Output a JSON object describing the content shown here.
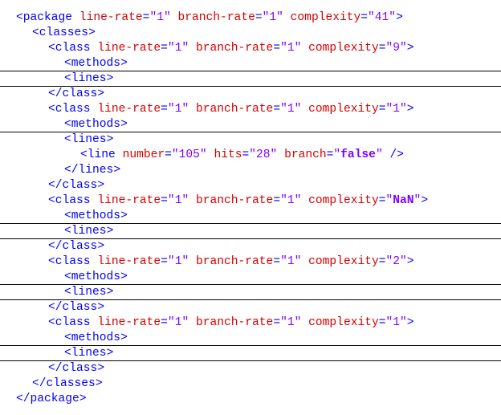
{
  "document": {
    "lines": [
      {
        "depth": 0,
        "tag": "package",
        "kind": "open",
        "attrs": [
          {
            "name": "line-rate",
            "value": "1"
          },
          {
            "name": "branch-rate",
            "value": "1"
          },
          {
            "name": "complexity",
            "value": "41"
          }
        ]
      },
      {
        "depth": 1,
        "tag": "classes",
        "kind": "open",
        "attrs": []
      },
      {
        "depth": 2,
        "tag": "class",
        "kind": "open",
        "attrs": [
          {
            "name": "line-rate",
            "value": "1"
          },
          {
            "name": "branch-rate",
            "value": "1"
          },
          {
            "name": "complexity",
            "value": "9"
          }
        ]
      },
      {
        "depth": 3,
        "tag": "methods",
        "kind": "open",
        "attrs": [],
        "separator": true
      },
      {
        "depth": 3,
        "tag": "lines",
        "kind": "open",
        "attrs": [],
        "separator": true
      },
      {
        "depth": 2,
        "tag": "class",
        "kind": "close",
        "attrs": []
      },
      {
        "depth": 2,
        "tag": "class",
        "kind": "open",
        "attrs": [
          {
            "name": "line-rate",
            "value": "1"
          },
          {
            "name": "branch-rate",
            "value": "1"
          },
          {
            "name": "complexity",
            "value": "1"
          }
        ]
      },
      {
        "depth": 3,
        "tag": "methods",
        "kind": "open",
        "attrs": [],
        "separator": true
      },
      {
        "depth": 3,
        "tag": "lines",
        "kind": "open",
        "attrs": []
      },
      {
        "depth": 4,
        "tag": "line",
        "kind": "selfclose",
        "attrs": [
          {
            "name": "number",
            "value": "105"
          },
          {
            "name": "hits",
            "value": "28"
          },
          {
            "name": "branch",
            "value": "false",
            "bold": true
          }
        ]
      },
      {
        "depth": 3,
        "tag": "lines",
        "kind": "close",
        "attrs": []
      },
      {
        "depth": 2,
        "tag": "class",
        "kind": "close",
        "attrs": []
      },
      {
        "depth": 2,
        "tag": "class",
        "kind": "open",
        "attrs": [
          {
            "name": "line-rate",
            "value": "1"
          },
          {
            "name": "branch-rate",
            "value": "1"
          },
          {
            "name": "complexity",
            "value": "NaN",
            "bold": true
          }
        ]
      },
      {
        "depth": 3,
        "tag": "methods",
        "kind": "open",
        "attrs": [],
        "separator": true
      },
      {
        "depth": 3,
        "tag": "lines",
        "kind": "open",
        "attrs": [],
        "separator": true
      },
      {
        "depth": 2,
        "tag": "class",
        "kind": "close",
        "attrs": []
      },
      {
        "depth": 2,
        "tag": "class",
        "kind": "open",
        "attrs": [
          {
            "name": "line-rate",
            "value": "1"
          },
          {
            "name": "branch-rate",
            "value": "1"
          },
          {
            "name": "complexity",
            "value": "2"
          }
        ]
      },
      {
        "depth": 3,
        "tag": "methods",
        "kind": "open",
        "attrs": [],
        "separator": true
      },
      {
        "depth": 3,
        "tag": "lines",
        "kind": "open",
        "attrs": [],
        "separator": true
      },
      {
        "depth": 2,
        "tag": "class",
        "kind": "close",
        "attrs": []
      },
      {
        "depth": 2,
        "tag": "class",
        "kind": "open",
        "attrs": [
          {
            "name": "line-rate",
            "value": "1"
          },
          {
            "name": "branch-rate",
            "value": "1"
          },
          {
            "name": "complexity",
            "value": "1"
          }
        ]
      },
      {
        "depth": 3,
        "tag": "methods",
        "kind": "open",
        "attrs": [],
        "separator": true
      },
      {
        "depth": 3,
        "tag": "lines",
        "kind": "open",
        "attrs": [],
        "separator": true
      },
      {
        "depth": 2,
        "tag": "class",
        "kind": "close",
        "attrs": []
      },
      {
        "depth": 1,
        "tag": "classes",
        "kind": "close",
        "attrs": []
      },
      {
        "depth": 0,
        "tag": "package",
        "kind": "close",
        "attrs": []
      }
    ]
  },
  "colors": {
    "tag": "#0000ff",
    "attribute_name": "#d60000",
    "attribute_value": "#8000ff",
    "separator": "#000000"
  }
}
